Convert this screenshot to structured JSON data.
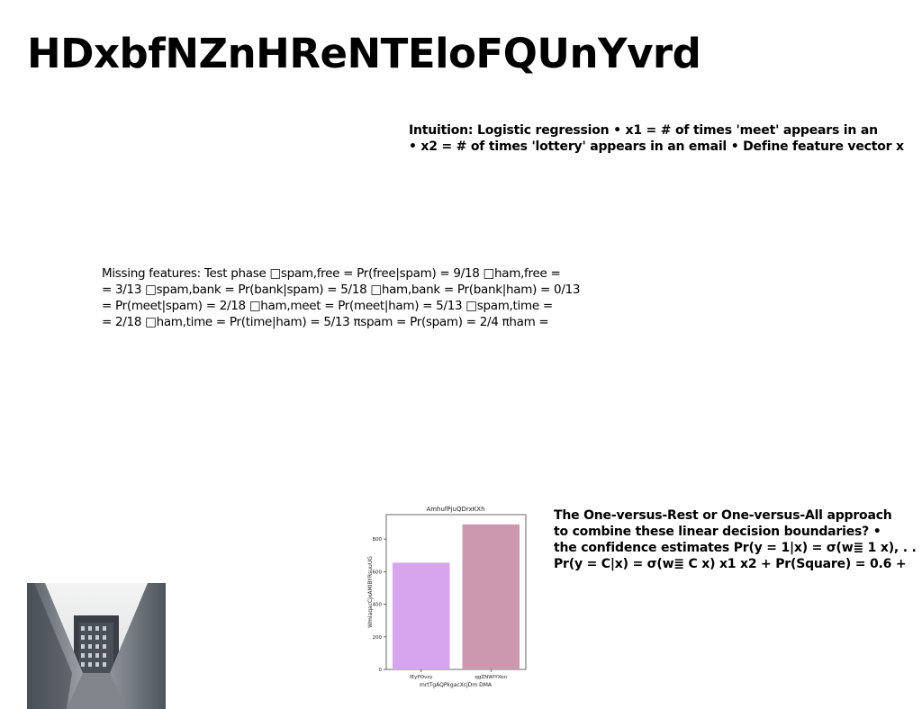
{
  "title": "HDxbfNZnHReNTEloFQUnYvrd",
  "intuition": {
    "lines": [
      "Intuition: Logistic regression • x1 = # of times 'meet' appears in an",
      "• x2 = # of times 'lottery' appears in an email • Define feature vector x"
    ]
  },
  "missing_features": {
    "lines": [
      "Missing features: Test phase □spam,free = Pr(free|spam) = 9/18 □ham,free =",
      "= 3/13 □spam,bank = Pr(bank|spam) = 5/18 □ham,bank = Pr(bank|ham) = 0/13",
      "= Pr(meet|spam) = 2/18 □ham,meet = Pr(meet|ham) = 5/13 □spam,time =",
      "= 2/18 □ham,time = Pr(time|ham) = 5/13 πspam = Pr(spam) = 2/4 πham ="
    ]
  },
  "ovr": {
    "lines": [
      "The One-versus-Rest or One-versus-All approach",
      "to combine these linear decision boundaries? •",
      "the confidence estimates Pr(y = 1|x) = σ(w≣ 1 x), . .",
      "Pr(y = C|x) = σ(w≣ C x) x1 x2 + Pr(Square) = 0.6 +"
    ]
  },
  "photo": {
    "icon": "building-photo-icon"
  },
  "chart_data": {
    "type": "bar",
    "title": "AmhufPjuQDrxKXh",
    "xlabel": "mrtTgAQPkgacXcjDm DMA",
    "ylabel": "WmiaqacCjxAMIBYRsuuUG",
    "categories": [
      "IEyPOvzy",
      "qgZNWIYXen"
    ],
    "values": [
      655,
      890
    ],
    "colors": [
      "#d6a5ee",
      "#cc98ad"
    ],
    "ylim": [
      0,
      950
    ],
    "yticks": [
      0,
      200,
      400,
      600,
      800
    ],
    "grid": false
  }
}
